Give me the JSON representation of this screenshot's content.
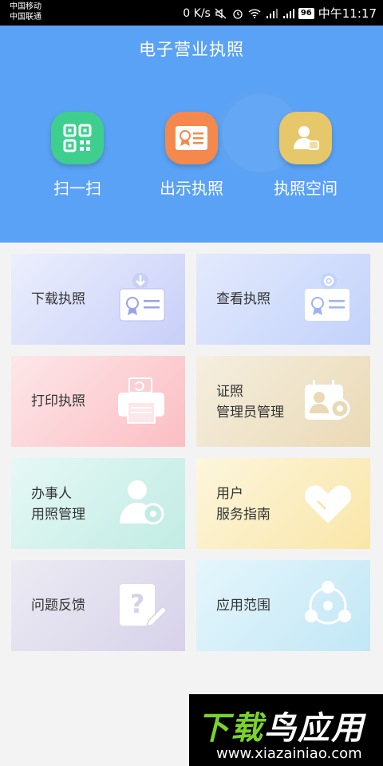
{
  "status_bar": {
    "carrier_1": "中国移动",
    "carrier_2": "中国联通",
    "speed": "0 K/s",
    "battery": "96",
    "time": "中午11:17"
  },
  "header": {
    "title": "电子营业执照",
    "buttons": [
      {
        "label": "扫一扫",
        "icon": "qr-scan-icon",
        "color": "#3ecf8e"
      },
      {
        "label": "出示执照",
        "icon": "license-card-icon",
        "color": "#f4894d"
      },
      {
        "label": "执照空间",
        "icon": "person-badge-icon",
        "color": "#e6c76a"
      }
    ]
  },
  "tiles": [
    {
      "line1": "下载执照",
      "line2": "",
      "icon": "download-license-icon"
    },
    {
      "line1": "查看执照",
      "line2": "",
      "icon": "view-license-icon"
    },
    {
      "line1": "打印执照",
      "line2": "",
      "icon": "printer-icon"
    },
    {
      "line1": "证照",
      "line2": "管理员管理",
      "icon": "admin-settings-icon"
    },
    {
      "line1": "办事人",
      "line2": "用照管理",
      "icon": "agent-settings-icon"
    },
    {
      "line1": "用户",
      "line2": "服务指南",
      "icon": "heart-icon"
    },
    {
      "line1": "问题反馈",
      "line2": "",
      "icon": "feedback-icon"
    },
    {
      "line1": "应用范围",
      "line2": "",
      "icon": "share-nodes-icon"
    }
  ],
  "watermark": {
    "name_part_1": "下载",
    "name_part_2": "鸟应用",
    "url": "www.xiazainiao.com"
  }
}
